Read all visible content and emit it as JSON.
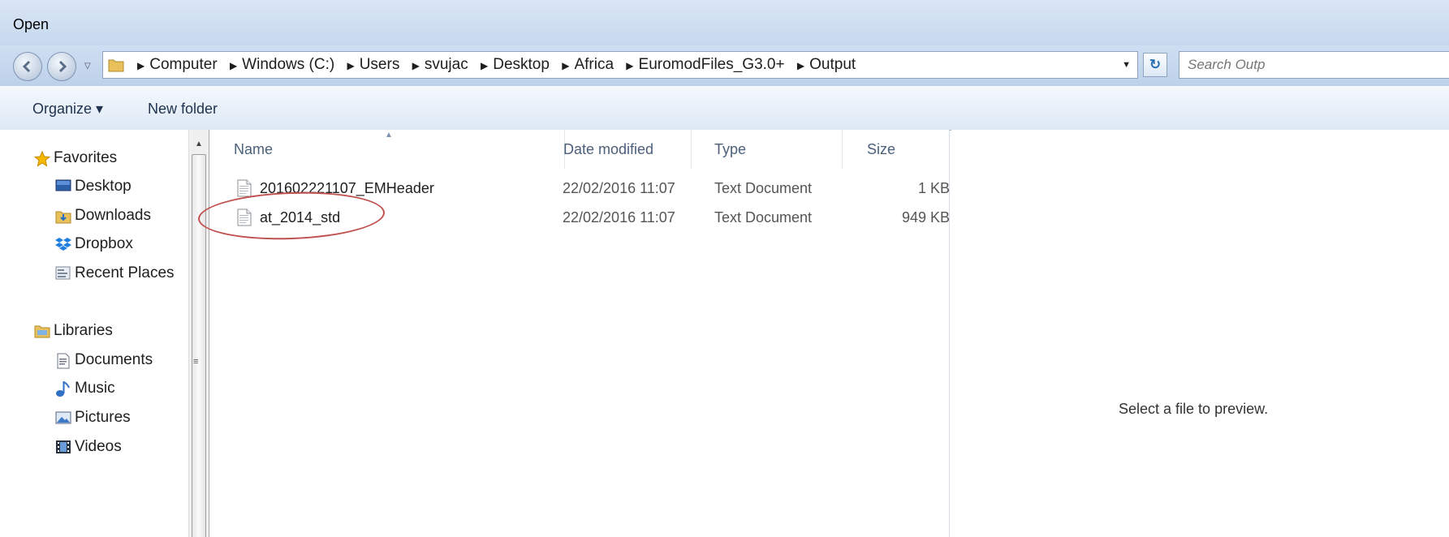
{
  "window": {
    "title": "Open"
  },
  "navigation": {
    "breadcrumbs": [
      "Computer",
      "Windows (C:)",
      "Users",
      "svujac",
      "Desktop",
      "Africa",
      "EuromodFiles_G3.0+",
      "Output"
    ],
    "search_placeholder": "Search Outp"
  },
  "toolbar": {
    "organize_label": "Organize ▾",
    "new_folder_label": "New folder"
  },
  "sidebar": {
    "favorites": {
      "label": "Favorites",
      "items": [
        "Desktop",
        "Downloads",
        "Dropbox",
        "Recent Places"
      ]
    },
    "libraries": {
      "label": "Libraries",
      "items": [
        "Documents",
        "Music",
        "Pictures",
        "Videos"
      ]
    }
  },
  "file_list": {
    "columns": [
      "Name",
      "Date modified",
      "Type",
      "Size"
    ],
    "files": [
      {
        "name": "201602221107_EMHeader",
        "date_modified": "22/02/2016 11:07",
        "type": "Text Document",
        "size": "1 KB"
      },
      {
        "name": "at_2014_std",
        "date_modified": "22/02/2016 11:07",
        "type": "Text Document",
        "size": "949 KB"
      }
    ]
  },
  "preview": {
    "message": "Select a file to preview."
  },
  "colors": {
    "annotation": "#c0504d",
    "chrome": "#c7d8ee"
  }
}
